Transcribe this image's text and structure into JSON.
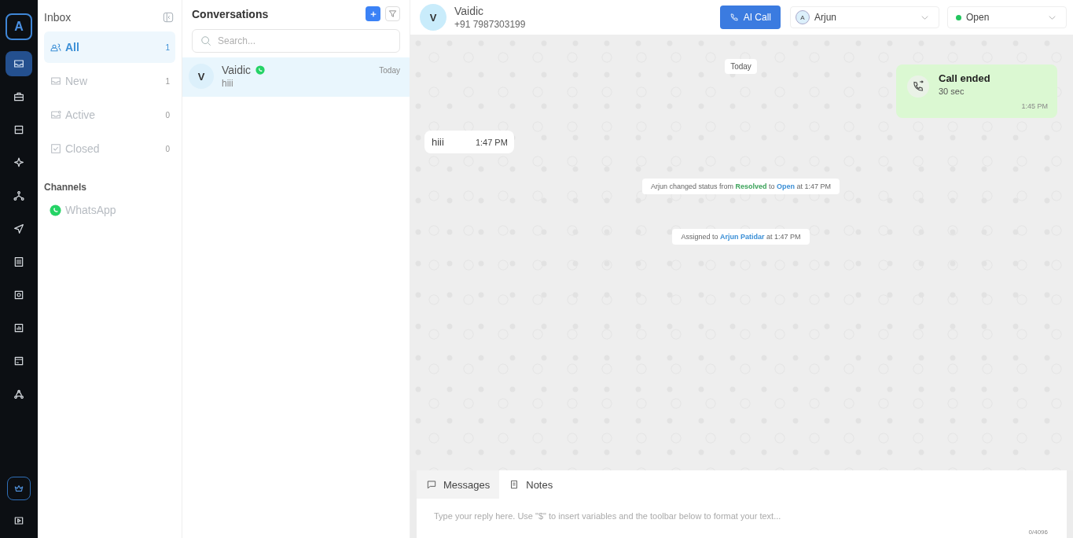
{
  "rail": {
    "logo": "A",
    "items": [
      {
        "selected": true
      },
      {
        "selected": false
      },
      {
        "selected": false
      },
      {
        "selected": false
      },
      {
        "selected": false
      },
      {
        "selected": false
      },
      {
        "selected": false
      },
      {
        "selected": false
      },
      {
        "selected": false
      },
      {
        "selected": false
      },
      {
        "selected": false
      }
    ],
    "bottom": [
      {
        "selected": true
      },
      {
        "selected": false
      }
    ]
  },
  "inbox": {
    "title": "Inbox",
    "filters": [
      {
        "label": "All",
        "count": "1",
        "selected": true
      },
      {
        "label": "New",
        "count": "1",
        "selected": false
      },
      {
        "label": "Active",
        "count": "0",
        "selected": false
      },
      {
        "label": "Closed",
        "count": "0",
        "selected": false
      }
    ],
    "channels_title": "Channels",
    "channels": [
      {
        "label": "WhatsApp"
      }
    ]
  },
  "conversations": {
    "title": "Conversations",
    "search": {
      "placeholder": "Search..."
    },
    "items": [
      {
        "initial": "V",
        "name": "Vaidic",
        "preview": "hiii",
        "time": "Today",
        "selected": true
      }
    ]
  },
  "chat": {
    "contact": {
      "initial": "V",
      "name": "Vaidic",
      "phone": "+91 7987303199"
    },
    "call_button": "AI Call",
    "assignee": {
      "initial": "A",
      "name": "Arjun"
    },
    "status": {
      "label": "Open"
    },
    "messages": [
      {
        "kind": "date",
        "text": "Today"
      },
      {
        "kind": "call",
        "title": "Call ended",
        "duration": "30 sec",
        "time": "1:45 PM"
      },
      {
        "kind": "incoming",
        "text": "hiii",
        "time": "1:47 PM"
      },
      {
        "kind": "event",
        "parts": [
          {
            "text": "Arjun changed status from "
          },
          {
            "text": "Resolved",
            "color": "#3ca35a"
          },
          {
            "text": " to "
          },
          {
            "text": "Open",
            "color": "#3b8fd6"
          },
          {
            "text": " at 1:47 PM"
          }
        ]
      },
      {
        "kind": "event",
        "parts": [
          {
            "text": "Assigned to "
          },
          {
            "text": "Arjun Patidar",
            "color": "#3b8fd6"
          },
          {
            "text": " at 1:47 PM"
          }
        ]
      }
    ],
    "composer": {
      "tabs": [
        {
          "label": "Messages",
          "selected": true
        },
        {
          "label": "Notes",
          "selected": false
        }
      ],
      "placeholder": "Type your reply here. Use \"$\" to insert variables and the toolbar below to format your text...",
      "counter": "0/4096"
    }
  }
}
